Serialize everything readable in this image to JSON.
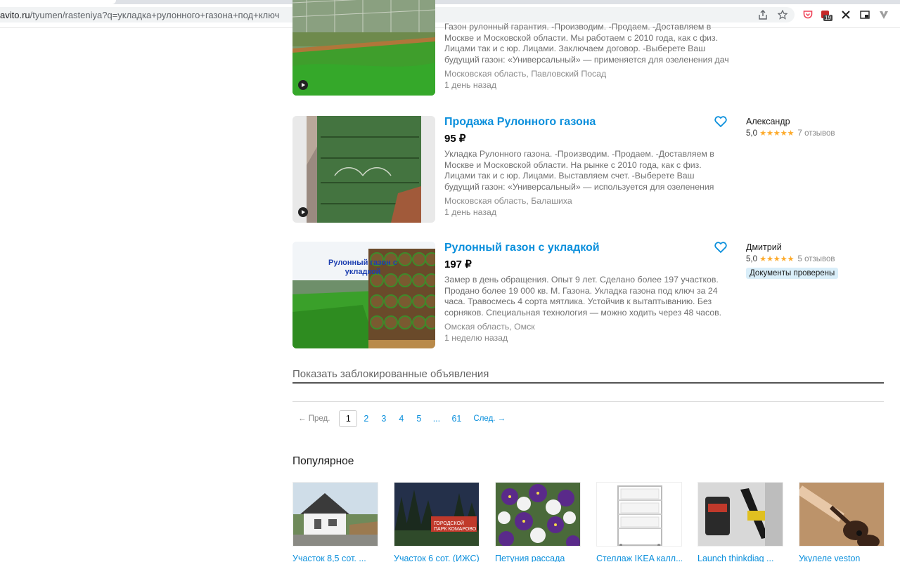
{
  "browser": {
    "url_host": "avito.ru",
    "url_path": "/tyumen/rasteniya?q=укладка+рулонного+газона+под+ключ",
    "extension_badge": "19"
  },
  "listings": [
    {
      "title": "",
      "price": "",
      "desc": "Газон рулонный гарантия. -Производим. -Продаем. -Доставляем в Москве и Московской области. Мы работаем с 2010 года, как с физ. Лицами так и с юр. Лицами. Заключаем договор. -Выберете Ваш будущий газон: «Универсальный» — применяется для озеленения дач",
      "location": "Московская область, Павловский Посад",
      "date": "1 день назад"
    },
    {
      "title": "Продажа Рулонного газона",
      "price": "95 ₽",
      "desc": "Укладка Рулонного газона. -Производим. -Продаем. -Доставляем в Москве и Московской области. На рынке с 2010 года, как с физ. Лицами так и с юр. Лицами. Выставляем счет. -Выберете Ваш будущий газон: «Универсальный» — используется для озеленения",
      "location": "Московская область, Балашиха",
      "date": "1 день назад",
      "seller": "Александр",
      "rating": "5,0",
      "stars": "★★★★★",
      "reviews": "7 отзывов"
    },
    {
      "title": "Рулонный газон с укладкой",
      "price": "197 ₽",
      "desc": "Замер в день обращения. Опыт 9 лет. Сделано более 197 участков. Продано более 19 000 кв. М. Газона. Укладка газона под ключ за 24 часа. Травосмесь 4 сорта мятлика. Устойчив к вытаптыванию. Без сорняков. Специальная технология — можно ходить через 48 часов.",
      "location": "Омская область, Омск",
      "date": "1 неделю назад",
      "seller": "Дмитрий",
      "rating": "5,0",
      "stars": "★★★★★",
      "reviews": "5 отзывов",
      "badge": "Документы проверены",
      "img_caption": "Рулонный газон с укладкой"
    }
  ],
  "show_blocked": "Показать заблокированные объявления",
  "pagination": {
    "prev": "← Пред.",
    "current": "1",
    "pages": [
      "2",
      "3",
      "4",
      "5",
      "...",
      "61"
    ],
    "next": "След. →"
  },
  "popular": {
    "title": "Популярное",
    "items": [
      {
        "label": "Участок 8,5 сот. ..."
      },
      {
        "label": "Участок 6 сот. (ИЖС)"
      },
      {
        "label": "Петуния рассада"
      },
      {
        "label": "Стеллаж IKEA калл..."
      },
      {
        "label": "Launch thinkdiag ..."
      },
      {
        "label": "Укулеле veston"
      }
    ],
    "park_sign": "ГОРОДСКОЙ ПАРК КОМАРОВО"
  },
  "colors": {
    "link": "#0a8fdc",
    "star": "#fdaa2a",
    "badge_bg": "#d9eef9"
  }
}
